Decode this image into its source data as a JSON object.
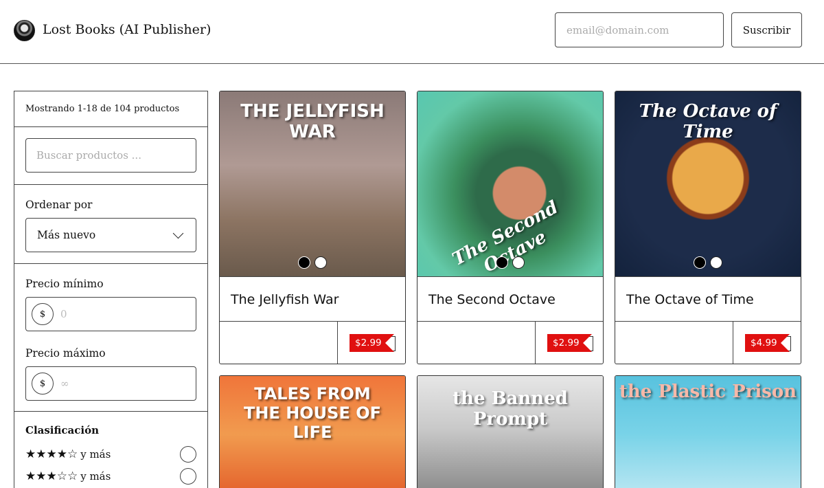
{
  "header": {
    "brand": "Lost Books (AI Publisher)",
    "email_placeholder": "email@domain.com",
    "subscribe_label": "Suscribir"
  },
  "sidebar": {
    "showing": "Mostrando 1-18 de 104 productos",
    "search_placeholder": "Buscar productos ...",
    "order_label": "Ordenar por",
    "order_value": "Más nuevo",
    "min_price_label": "Precio mínimo",
    "min_price_placeholder": "0",
    "max_price_label": "Precio máximo",
    "max_price_placeholder": "∞",
    "currency_symbol": "$",
    "rating_title": "Clasificación",
    "ratings": [
      {
        "stars": "★★★★☆",
        "label": "y más"
      },
      {
        "stars": "★★★☆☆",
        "label": "y más"
      }
    ]
  },
  "products": [
    {
      "title": "The Jellyfish War",
      "price": "$2.99",
      "cover_text": "THE JELLYFISH WAR"
    },
    {
      "title": "The Second Octave",
      "price": "$2.99",
      "cover_text": "The Second Octave"
    },
    {
      "title": "The Octave of Time",
      "price": "$4.99",
      "cover_text": "The Octave of Time"
    },
    {
      "title": "",
      "price": "",
      "cover_text": "TALES FROM THE HOUSE OF LIFE"
    },
    {
      "title": "",
      "price": "",
      "cover_text": "the Banned Prompt"
    },
    {
      "title": "",
      "price": "",
      "cover_text": "the Plastic Prison"
    }
  ],
  "colors": {
    "price_tag": "#e01010"
  }
}
